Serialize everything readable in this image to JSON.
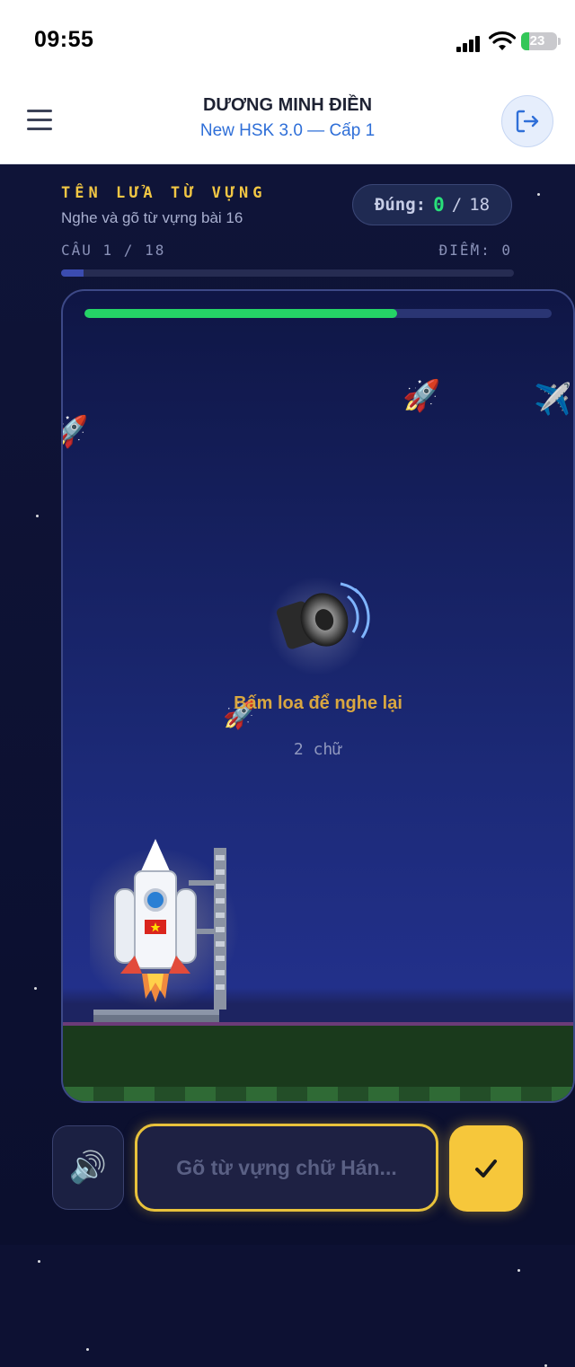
{
  "status_bar": {
    "time": "09:55",
    "battery": "23",
    "battery_level": 0.23
  },
  "header": {
    "user_name": "DƯƠNG MINH ĐIỀN",
    "course": "New HSK 3.0 — Cấp 1",
    "menu_icon": "hamburger-menu-icon",
    "logout_icon": "logout-icon"
  },
  "game": {
    "title": "TÊN LỬA TỪ VỰNG",
    "subtitle": "Nghe và gõ từ vựng bài 16",
    "score": {
      "label": "Đúng:",
      "correct": "0",
      "separator": "/",
      "total": "18"
    },
    "question_counter": "CÂU 1 / 18",
    "points": "ĐIỂM: 0",
    "question_progress": 0.05,
    "timer_level": 0.67,
    "speaker_icon": "speaker-icon",
    "hint": "Bấm loa để nghe lại",
    "char_count": "2 chữ"
  },
  "input": {
    "placeholder": "Gõ từ vựng chữ Hán...",
    "value": "",
    "sound_icon": "speaker-icon",
    "submit_icon": "checkmark-icon"
  },
  "colors": {
    "accent": "#f2c744",
    "correct": "#29e07a",
    "link": "#2f6fd8",
    "timer": "#25d366",
    "submit": "#f6c73b",
    "background": "#0d1133"
  }
}
